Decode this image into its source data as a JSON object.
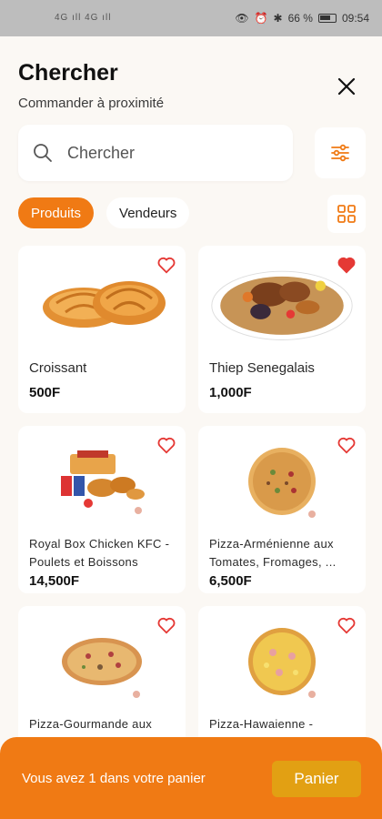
{
  "status": {
    "signal": "4G ıll 4G ıll",
    "battery": "66 %",
    "time": "09:54"
  },
  "header": {
    "title": "Chercher",
    "subtitle": "Commander à proximité"
  },
  "search": {
    "placeholder": "Chercher"
  },
  "tabs": [
    {
      "label": "Produits"
    },
    {
      "label": "Vendeurs"
    }
  ],
  "products": [
    {
      "name": "Croissant",
      "price": "500F",
      "favorite": false
    },
    {
      "name": "Thiep Senegalais",
      "price": "1,000F",
      "favorite": true
    },
    {
      "name": "Royal Box Chicken KFC - Poulets et Boissons",
      "price": "14,500F",
      "favorite": false
    },
    {
      "name": "Pizza-Arménienne aux Tomates, Fromages, ...",
      "price": "6,500F",
      "favorite": false
    },
    {
      "name": "Pizza-Gourmande aux Tomates, Fromages, ...",
      "price": "",
      "favorite": false
    },
    {
      "name": "Pizza-Hawaienne - Tomate, fromage, ...",
      "price": "",
      "favorite": false
    }
  ],
  "cart": {
    "message": "Vous avez 1 dans votre panier",
    "button": "Panier"
  },
  "colors": {
    "accent": "#f07a14",
    "cart_button": "#e2a013",
    "heart": "#e53935"
  }
}
